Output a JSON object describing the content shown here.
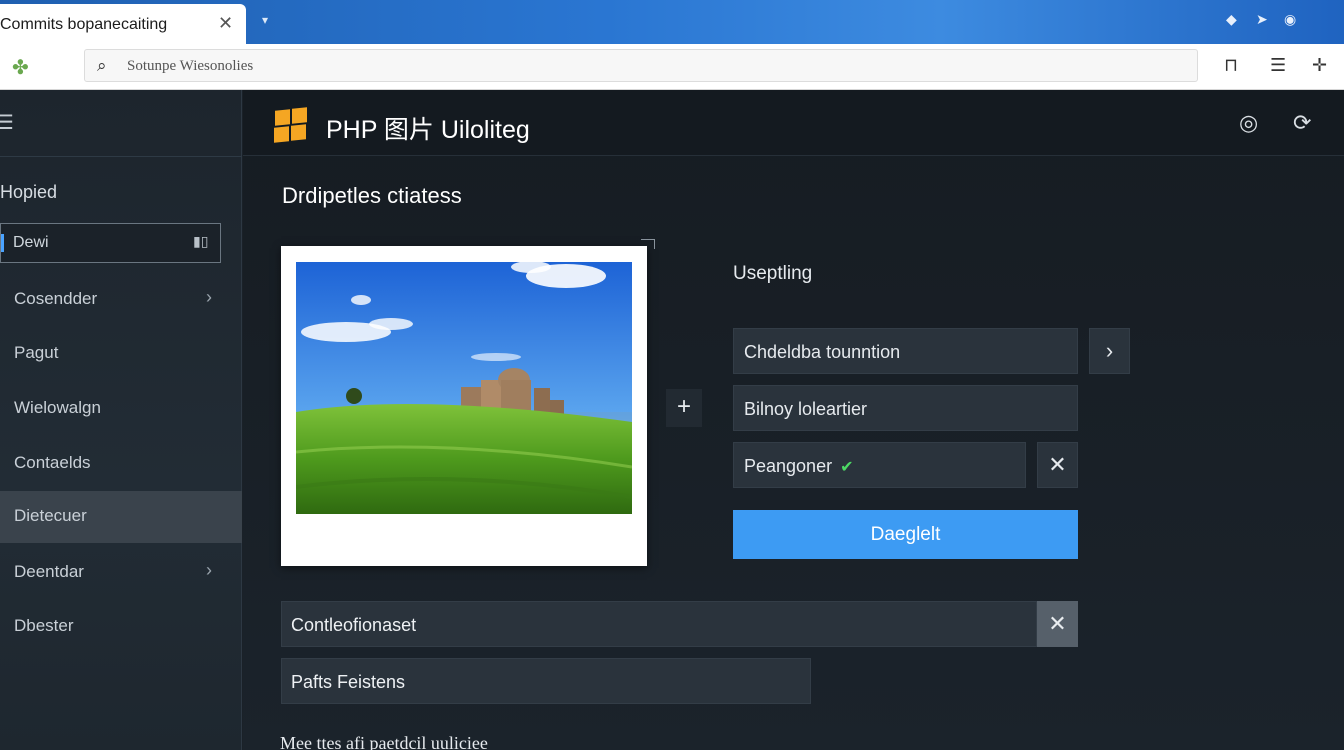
{
  "browser": {
    "tab_title": "Commits bopanecaiting",
    "tab_close": "✕",
    "new_tab": "▾",
    "tray_icons": [
      "◆",
      "➤",
      "◉"
    ],
    "address_placeholder": "Sotunpe Wiesonolies",
    "toolbar_icons": [
      "⊓",
      "☰",
      "✛"
    ]
  },
  "sidebar": {
    "heading": "Hopied",
    "search_value": "Dewi",
    "items": [
      {
        "label": "Cosendder",
        "chevron": true
      },
      {
        "label": "Pagut",
        "chevron": false
      },
      {
        "label": "Wielowalgn",
        "chevron": false
      },
      {
        "label": "Contaelds",
        "chevron": false
      },
      {
        "label": "Dietecuer",
        "chevron": false,
        "active": true
      },
      {
        "label": "Deentdar",
        "chevron": true
      },
      {
        "label": "Dbester",
        "chevron": false
      }
    ]
  },
  "header": {
    "title": "PHP 图片 Uiloliteg",
    "icon_left": "◎",
    "icon_right": "⟳"
  },
  "main": {
    "section_title": "Drdipetles ctiatess",
    "add_label": "+",
    "upload_heading": "Useptling",
    "fields": [
      {
        "label": "Chdeldba tounntion",
        "action": "›"
      },
      {
        "label": "Bilnoy loleartier"
      },
      {
        "label": "Peangoner",
        "check": "✔",
        "action": "✕"
      }
    ],
    "primary_button": "Daeglelt",
    "wide_fields": [
      {
        "label": "Contleofionaset",
        "action": "✕"
      },
      {
        "label": "Pafts Feistens"
      }
    ],
    "footer_text": "Mee ttes afi paetdcil uuliciee"
  },
  "colors": {
    "accent": "#3d9bf3",
    "logo": "#f5a623",
    "check": "#4cd964"
  }
}
